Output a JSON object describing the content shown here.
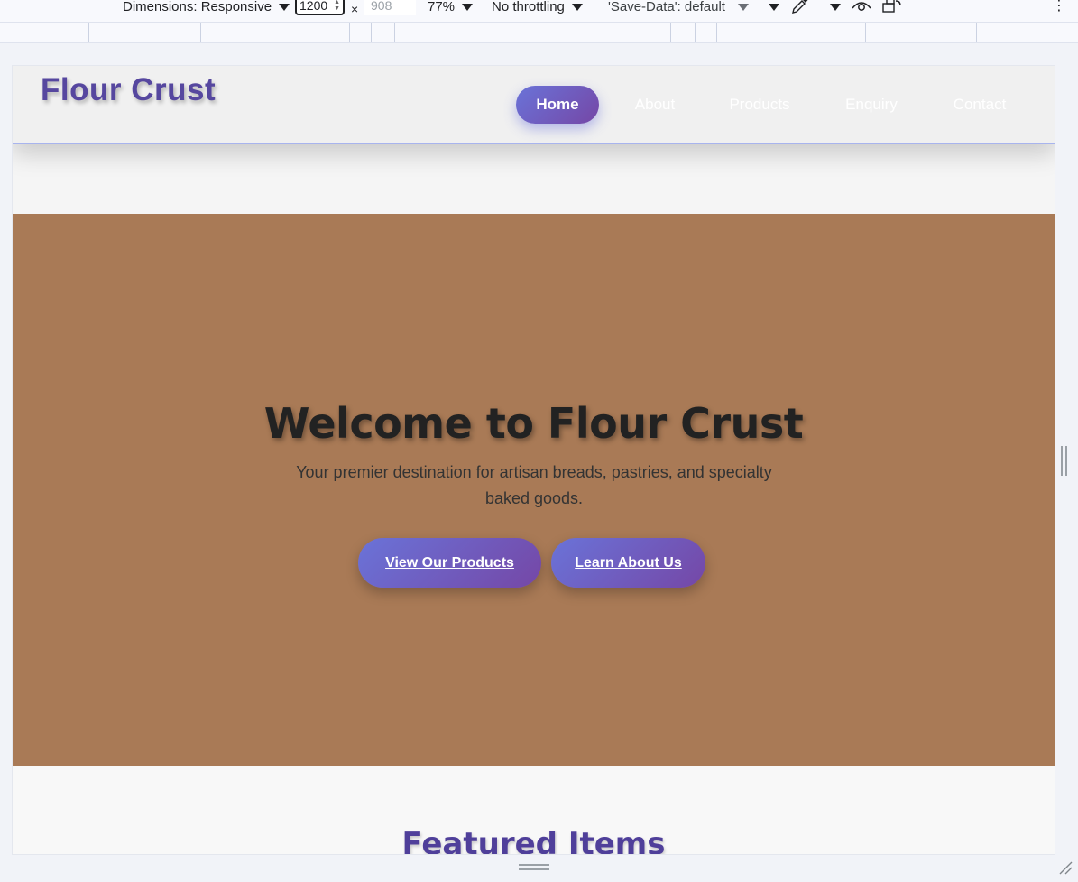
{
  "devtools": {
    "dimensions_label": "Dimensions: Responsive",
    "width_value": "1200",
    "times_sign": "×",
    "height_placeholder": "908",
    "zoom": "77%",
    "throttling": "No throttling",
    "save_data": "'Save-Data': default",
    "more_glyph": "⋮"
  },
  "site": {
    "logo": "Flour Crust",
    "nav": [
      {
        "label": "Home",
        "active": true
      },
      {
        "label": "About",
        "active": false
      },
      {
        "label": "Products",
        "active": false
      },
      {
        "label": "Enquiry",
        "active": false
      },
      {
        "label": "Contact",
        "active": false
      }
    ],
    "hero": {
      "title": "Welcome to Flour Crust",
      "subtitle": "Your premier destination for artisan breads, pastries, and specialty baked goods.",
      "buttons": [
        {
          "label": "View Our Products"
        },
        {
          "label": "Learn About Us"
        }
      ]
    },
    "featured": {
      "title": "Featured Items"
    }
  },
  "colors": {
    "brand": "#56479f",
    "accent_gradient_start": "#6a73d8",
    "accent_gradient_end": "#7547a6",
    "hero_bg": "#a97a56"
  },
  "icons": [
    "eyedropper-icon",
    "vision-deficiency-icon",
    "rotate-icon",
    "more-options-icon"
  ]
}
